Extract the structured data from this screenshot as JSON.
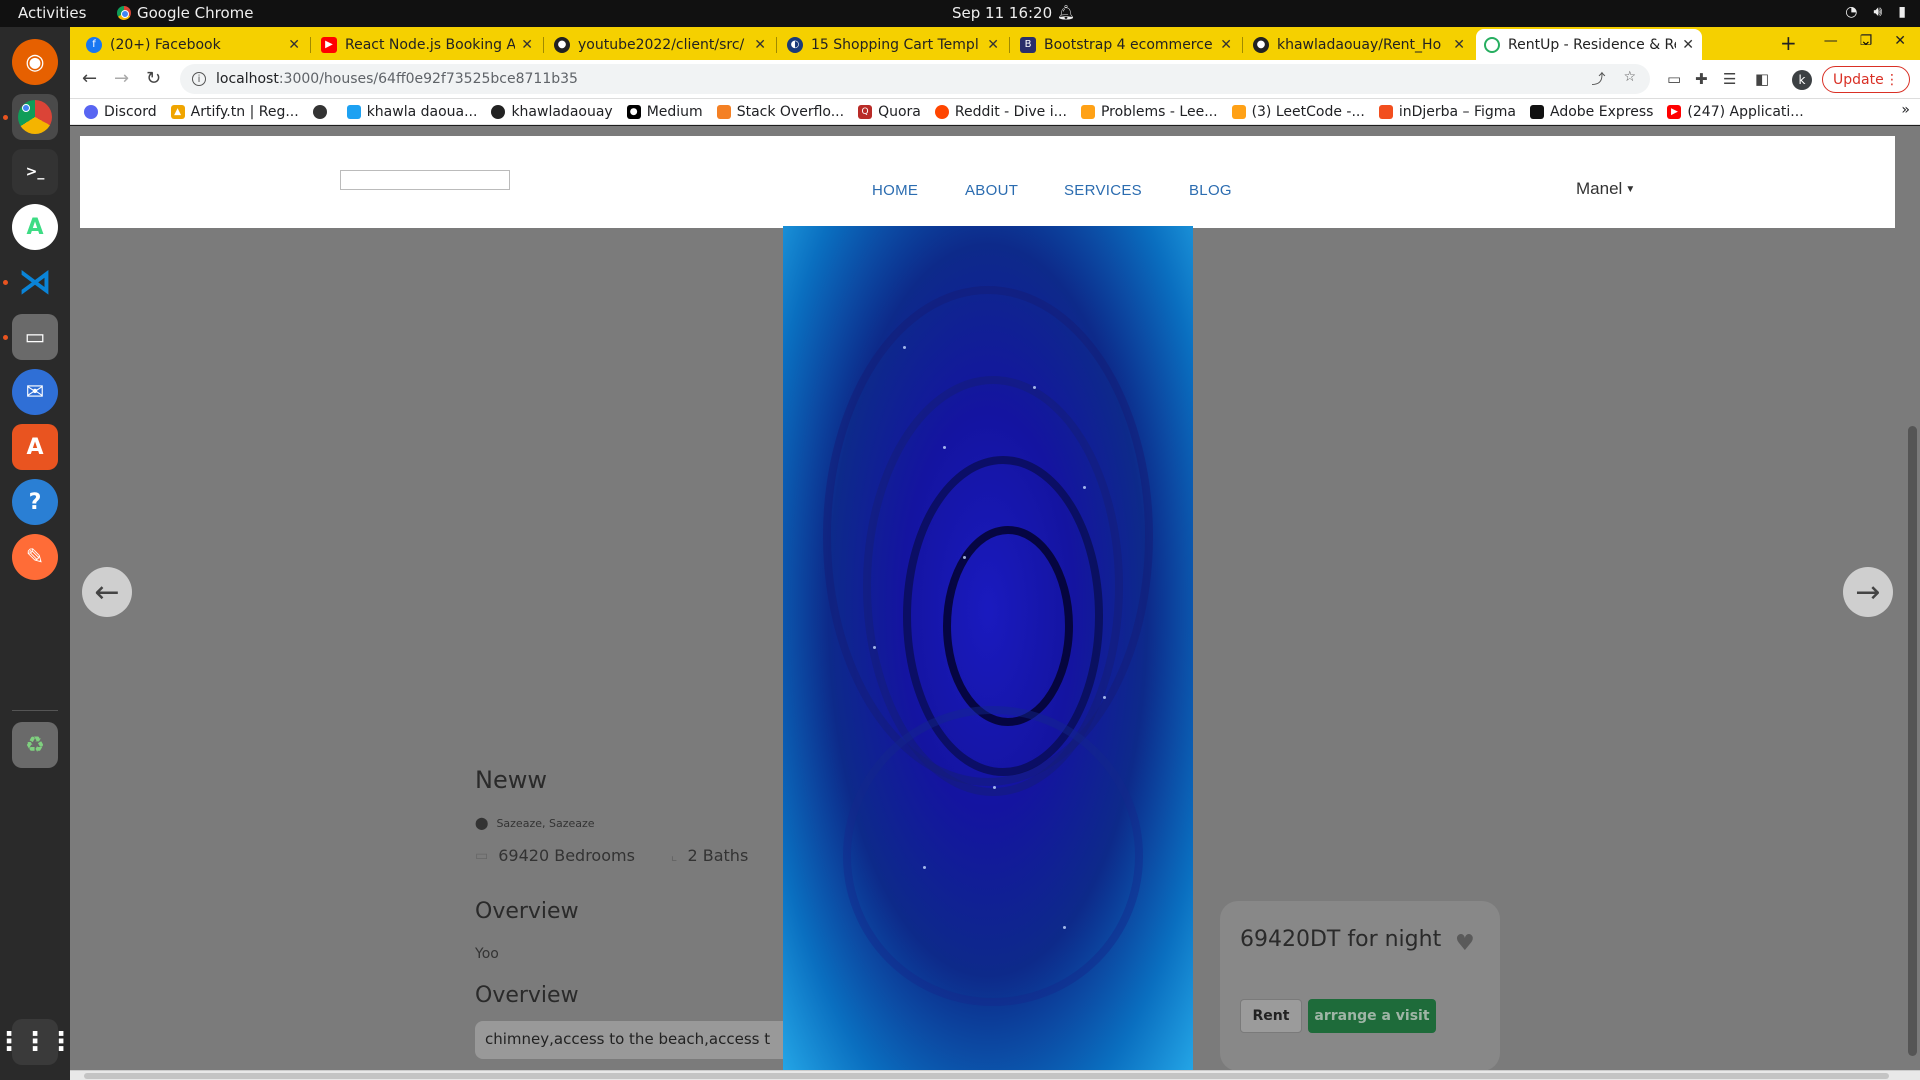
{
  "system_bar": {
    "activities": "Activities",
    "app_name": "Google Chrome",
    "clock": "Sep 11  16:20"
  },
  "dock": {
    "apps": [
      {
        "name": "firefox-icon",
        "color": "#e66000"
      },
      {
        "name": "chrome-icon",
        "color": "#4285f4"
      },
      {
        "name": "terminal-icon",
        "color": "#333333"
      },
      {
        "name": "android-studio-icon",
        "color": "#3ddc84"
      },
      {
        "name": "vscode-icon",
        "color": "#0a66b8"
      },
      {
        "name": "files-icon",
        "color": "#888888"
      },
      {
        "name": "thunderbird-icon",
        "color": "#2f6fd6"
      },
      {
        "name": "app-store-icon",
        "color": "#e95420"
      },
      {
        "name": "help-icon",
        "color": "#2a7fd4"
      },
      {
        "name": "postman-icon",
        "color": "#ff6c37"
      },
      {
        "name": "trash-icon",
        "color": "#5a8a5a"
      }
    ]
  },
  "tabs": [
    {
      "title": "(20+) Facebook",
      "favicon": "facebook-icon",
      "color": "#1877f2"
    },
    {
      "title": "React Node.js Booking A",
      "favicon": "youtube-icon",
      "color": "#ff0000"
    },
    {
      "title": "youtube2022/client/src/",
      "favicon": "github-icon",
      "color": "#222222"
    },
    {
      "title": "15 Shopping Cart Templ",
      "favicon": "site-icon",
      "color": "#1a3b7a"
    },
    {
      "title": "Bootstrap 4 ecommerce",
      "favicon": "bootstrap-icon",
      "color": "#2a2f6b"
    },
    {
      "title": "khawladaouay/Rent_Ho",
      "favicon": "github-icon",
      "color": "#222222"
    },
    {
      "title": "RentUp - Residence & Re",
      "favicon": "rentup-icon",
      "color": "#27ae60",
      "active": true
    }
  ],
  "address_bar": {
    "host": "localhost",
    "path": ":3000/houses/64ff0e92f73525bce8711b35"
  },
  "browser": {
    "avatar_letter": "k",
    "update_label": "Update"
  },
  "bookmarks": [
    {
      "label": "Discord",
      "color": "#5865f2"
    },
    {
      "label": "Artify.tn | Reg...",
      "color": "#f0a500"
    },
    {
      "label": "",
      "color": "#333333"
    },
    {
      "label": "khawla daoua...",
      "color": "#1da1f2"
    },
    {
      "label": "khawladaouay",
      "color": "#222222"
    },
    {
      "label": "Medium",
      "color": "#000000"
    },
    {
      "label": "Stack Overflo...",
      "color": "#f48024"
    },
    {
      "label": "Quora",
      "color": "#b92b27"
    },
    {
      "label": "Reddit - Dive i...",
      "color": "#ff4500"
    },
    {
      "label": "Problems - Lee...",
      "color": "#ffa116"
    },
    {
      "label": "(3) LeetCode -...",
      "color": "#ffa116"
    },
    {
      "label": "inDjerba – Figma",
      "color": "#f24e1e"
    },
    {
      "label": "Adobe Express",
      "color": "#111111"
    },
    {
      "label": "(247) Applicati...",
      "color": "#ff0000"
    }
  ],
  "site": {
    "nav": {
      "home": "HOME",
      "about": "ABOUT",
      "services": "SERVICES",
      "blog": "BLOG",
      "user": "Manel"
    },
    "house": {
      "title": "Neww",
      "location": "Sazeaze,  Sazeaze",
      "bedrooms": "69420 Bedrooms",
      "baths": "2 Baths",
      "overview_heading": "Overview",
      "overview_text": "Yoo",
      "amenities_heading": "Overview",
      "amenities": "chimney,access to the beach,access t"
    },
    "booking": {
      "price": "69420DT for night",
      "rent_label": "Rent",
      "visit_label": "arrange a visit"
    }
  }
}
